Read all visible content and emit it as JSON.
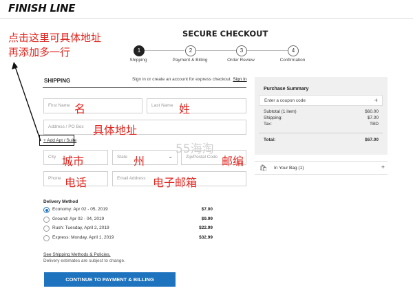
{
  "header": {
    "logo": "FINISH LINE"
  },
  "page": {
    "title": "SECURE CHECKOUT"
  },
  "steps": [
    {
      "number": "1",
      "label": "Shipping",
      "active": true
    },
    {
      "number": "2",
      "label": "Payment & Billing",
      "active": false
    },
    {
      "number": "3",
      "label": "Order Review",
      "active": false
    },
    {
      "number": "4",
      "label": "Confirmation",
      "active": false
    }
  ],
  "shipping": {
    "title": "SHIPPING",
    "note": "Sign in or create an account for express checkout.",
    "sign_in": "Sign In",
    "fields": {
      "first_name": "First Name",
      "last_name": "Last Name",
      "address": "Address / PO Box",
      "add_apt": "+ Add Apt / Suite",
      "city": "City",
      "state": "State",
      "zip": "Zip/Postal Code",
      "phone": "Phone",
      "email": "Email Address"
    }
  },
  "delivery": {
    "title": "Delivery Method",
    "options": [
      {
        "label": "Economy: Apr 02 - 05, 2019",
        "price": "$7.00",
        "selected": true
      },
      {
        "label": "Ground: Apr 02 - 04, 2019",
        "price": "$9.99",
        "selected": false
      },
      {
        "label": "Rush: Tuesday, April 2, 2019",
        "price": "$22.99",
        "selected": false
      },
      {
        "label": "Express: Monday, April 1, 2019",
        "price": "$32.99",
        "selected": false
      }
    ],
    "see_methods": "See Shipping Methods & Policies.",
    "estimates_note": "Delivery estimates are subject to change."
  },
  "cta": {
    "continue": "CONTINUE TO PAYMENT & BILLING"
  },
  "summary": {
    "title": "Purchase Summary",
    "coupon": "Enter a coupon code",
    "subtotal_label": "Subtotal (1 item)",
    "subtotal_value": "$60.00",
    "shipping_label": "Shipping:",
    "shipping_value": "$7.00",
    "tax_label": "Tax:",
    "tax_value": "TBD",
    "total_label": "Total:",
    "total_value": "$67.00"
  },
  "bag": {
    "label": "In Your Bag (1)"
  },
  "annotations": {
    "line1": "点击这里可具体地址",
    "line2": "再添加多一行",
    "first_name": "名",
    "last_name": "姓",
    "address": "具体地址",
    "city": "城市",
    "state": "州",
    "zip": "邮编",
    "phone": "电话",
    "email": "电子邮箱",
    "watermark": "55海淘"
  },
  "colors": {
    "accent": "#1e73be",
    "annotation": "#e0261f"
  }
}
